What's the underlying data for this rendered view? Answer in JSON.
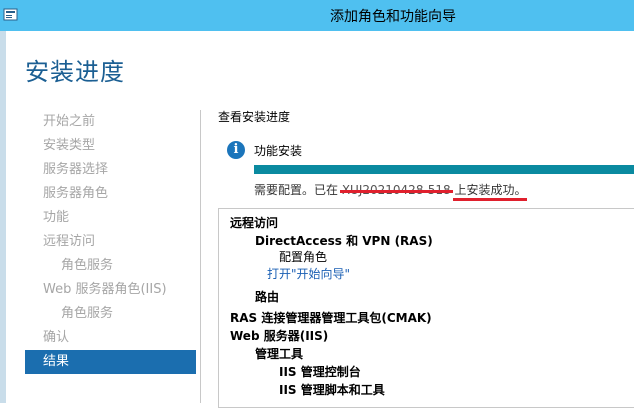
{
  "window": {
    "title": "添加角色和功能向导",
    "icon": "server-manager-wizard-icon"
  },
  "page": {
    "heading": "安装进度"
  },
  "nav": {
    "items": [
      {
        "label": "开始之前",
        "level": 0,
        "active": false
      },
      {
        "label": "安装类型",
        "level": 0,
        "active": false
      },
      {
        "label": "服务器选择",
        "level": 0,
        "active": false
      },
      {
        "label": "服务器角色",
        "level": 0,
        "active": false
      },
      {
        "label": "功能",
        "level": 0,
        "active": false
      },
      {
        "label": "远程访问",
        "level": 0,
        "active": false
      },
      {
        "label": "角色服务",
        "level": 1,
        "active": false
      },
      {
        "label": "Web 服务器角色(IIS)",
        "level": 0,
        "active": false
      },
      {
        "label": "角色服务",
        "level": 1,
        "active": false
      },
      {
        "label": "确认",
        "level": 0,
        "active": false
      },
      {
        "label": "结果",
        "level": 0,
        "active": true
      }
    ]
  },
  "content": {
    "section_label": "查看安装进度",
    "status": {
      "icon": "info-icon",
      "title": "功能安装",
      "progress": 1.0,
      "msg_prefix": "需要配置。已在 ",
      "msg_server": "XUJ20210428-518",
      "msg_suffix": " 上安装成功。"
    },
    "results": [
      {
        "text": "远程访问",
        "indent": 0,
        "style": "bold"
      },
      {
        "text": "DirectAccess 和 VPN (RAS)",
        "indent": 1,
        "style": "bold"
      },
      {
        "text": "配置角色",
        "indent": 2,
        "style": "normal"
      },
      {
        "text": "打开\"开始向导\"",
        "indent": 2,
        "style": "link"
      },
      {
        "text": "路由",
        "indent": 1,
        "style": "bold"
      },
      {
        "text": "RAS 连接管理器管理工具包(CMAK)",
        "indent": 0,
        "style": "bold"
      },
      {
        "text": "Web 服务器(IIS)",
        "indent": 0,
        "style": "bold"
      },
      {
        "text": "管理工具",
        "indent": 1,
        "style": "bold"
      },
      {
        "text": "IIS 管理控制台",
        "indent": 3,
        "style": "bold"
      },
      {
        "text": "IIS 管理脚本和工具",
        "indent": 3,
        "style": "bold"
      }
    ]
  },
  "colors": {
    "titlebar": "#4fc0f0",
    "heading": "#1b5f93",
    "nav_active": "#1b6eaf",
    "progress": "#0a8aa0",
    "annotation": "#e0202d"
  }
}
